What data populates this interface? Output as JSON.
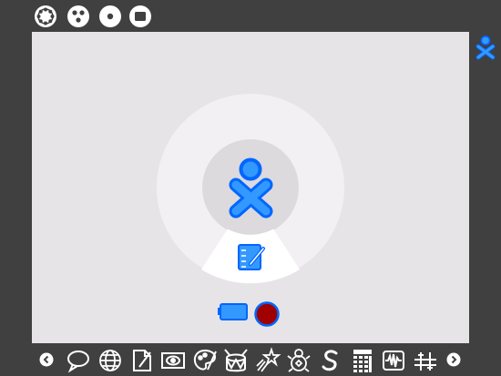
{
  "colors": {
    "frame": "#404040",
    "home_background": "#e6e4e6",
    "ring": "#f2f0f2",
    "center_disc": "#dcdadc",
    "xo_fill": "#3399ff",
    "xo_stroke": "#0066ff",
    "battery_fill": "#3399ff",
    "record_fill": "#a00000",
    "white": "#ffffff"
  },
  "top_bar": {
    "zoom_buttons": [
      {
        "icon": "zoom-neighborhood-icon"
      },
      {
        "icon": "zoom-groups-icon"
      },
      {
        "icon": "zoom-home-icon"
      },
      {
        "icon": "zoom-activity-icon"
      }
    ]
  },
  "right_bar": {
    "buddy_icon": "xo-buddy-icon"
  },
  "home": {
    "ring_items": [
      {
        "icon": "journal-icon"
      }
    ],
    "center_icon": "xo-owner-icon",
    "devices": [
      {
        "icon": "battery-icon"
      },
      {
        "icon": "record-icon"
      }
    ]
  },
  "bottom_bar": {
    "scroll_left_icon": "arrow-left-icon",
    "scroll_right_icon": "arrow-right-icon",
    "activities": [
      {
        "icon": "chat-icon"
      },
      {
        "icon": "browse-icon"
      },
      {
        "icon": "write-icon"
      },
      {
        "icon": "record-activity-icon"
      },
      {
        "icon": "paint-icon"
      },
      {
        "icon": "drum-icon"
      },
      {
        "icon": "tamtam-icon"
      },
      {
        "icon": "memorize-icon"
      },
      {
        "icon": "turtle-art-icon"
      },
      {
        "icon": "calculate-icon"
      },
      {
        "icon": "measure-icon"
      },
      {
        "icon": "etoys-icon"
      }
    ]
  }
}
